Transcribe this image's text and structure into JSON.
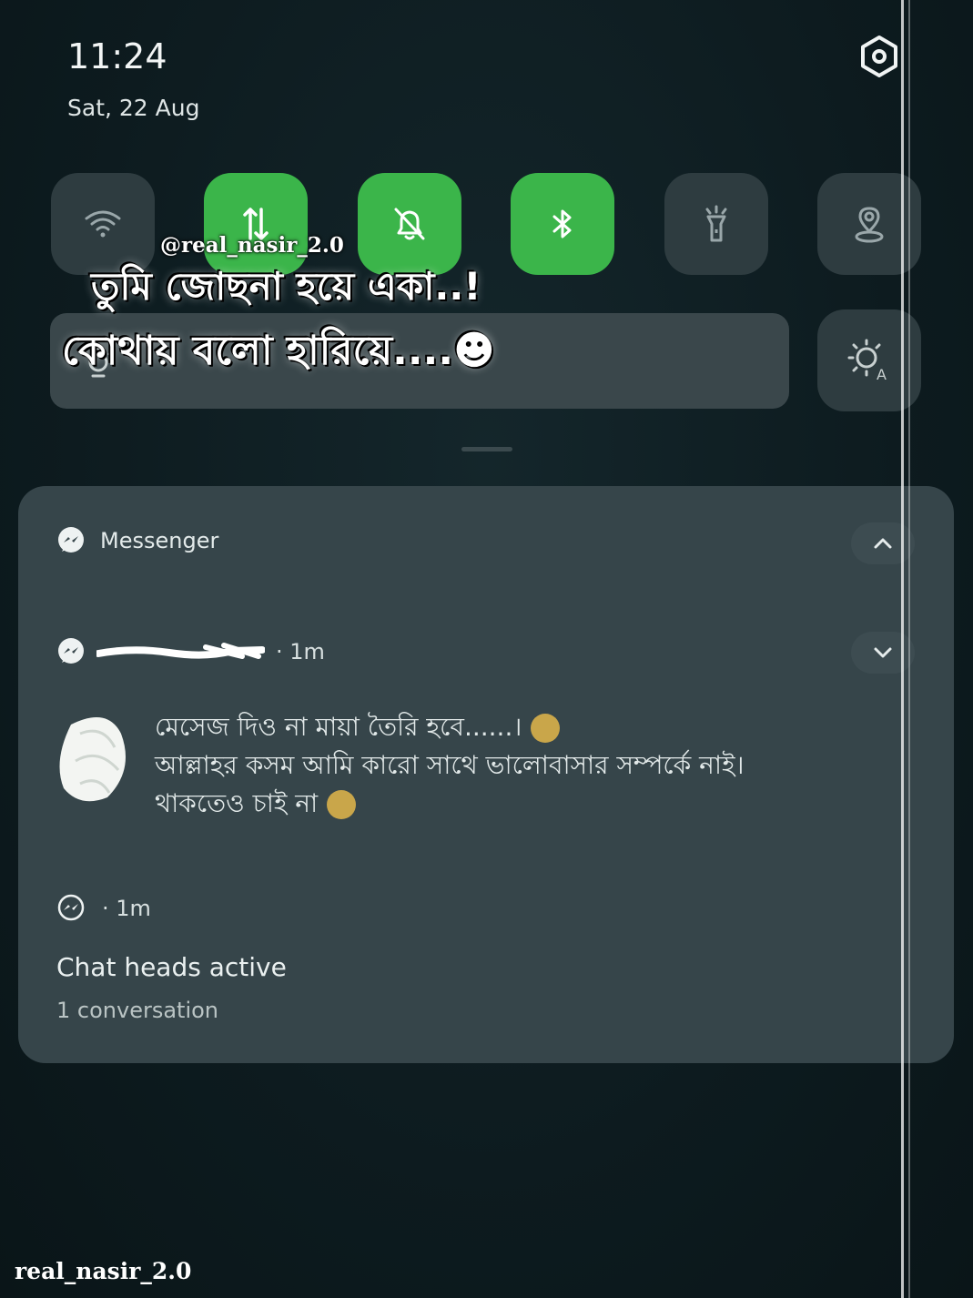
{
  "status": {
    "time": "11:24",
    "date": "Sat, 22 Aug"
  },
  "quick_tiles": [
    {
      "name": "wifi",
      "icon": "wifi-icon",
      "on": false
    },
    {
      "name": "mobile-data",
      "icon": "mobile-data-icon",
      "on": true
    },
    {
      "name": "silent",
      "icon": "bell-off-icon",
      "on": true
    },
    {
      "name": "bluetooth",
      "icon": "bluetooth-icon",
      "on": true
    },
    {
      "name": "flashlight",
      "icon": "flashlight-icon",
      "on": false
    },
    {
      "name": "location",
      "icon": "location-icon",
      "on": false
    }
  ],
  "overlay": {
    "handle": "@real_nasir_2.0",
    "line1": "তুমি জোছনা হয়ে একা..!",
    "line2": "কোথায় বলো হারিয়ে....☻"
  },
  "notification": {
    "app_name": "Messenger",
    "message": {
      "time": "· 1m",
      "line1": "মেসেজ দিও না মায়া তৈরি হবে......।",
      "line2": "আল্লাহর কসম আমি কারো সাথে ভালোবাসার সম্পর্কে নাই।",
      "line3": "থাকতেও চাই না"
    },
    "chat_heads": {
      "time": "· 1m",
      "title": "Chat heads active",
      "subtitle": "1 conversation"
    }
  },
  "watermark": "real_nasir_2.0",
  "colors": {
    "tile_on": "#3bb54a",
    "tile_off": "#2e3c40",
    "card": "#36454a",
    "background": "#0d1b1f"
  }
}
